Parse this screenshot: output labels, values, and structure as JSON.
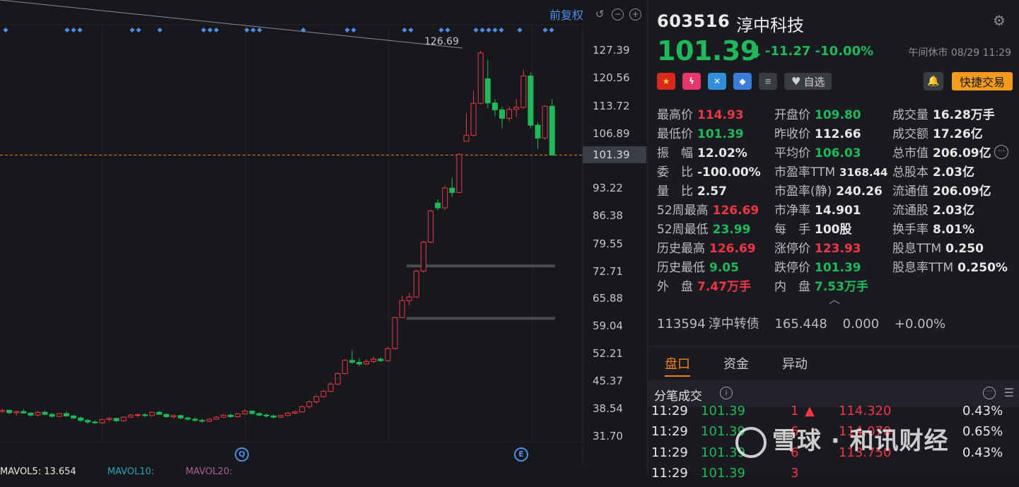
{
  "toolbar": {
    "adjust_label": "前复权"
  },
  "price_axis": [
    "127.39",
    "120.56",
    "113.72",
    "106.89",
    "101.39",
    "93.22",
    "86.38",
    "79.55",
    "72.71",
    "65.88",
    "59.04",
    "52.21",
    "45.37",
    "38.54",
    "31.70"
  ],
  "chart_annotations": {
    "high_label": "126.69",
    "marker_q": "Q",
    "marker_e": "E"
  },
  "mavol": {
    "ma5": "MAVOL5: 13.654",
    "ma10": "MAVOL10:",
    "ma20": "MAVOL20:"
  },
  "chart_data": {
    "type": "candlestick",
    "y_range": [
      31.7,
      127.39
    ],
    "current_price": 101.39,
    "period_high": 126.69,
    "candles": [
      [
        37.8,
        38.5,
        37.4,
        38.1
      ],
      [
        38.1,
        38.3,
        37.2,
        37.5
      ],
      [
        37.5,
        38.0,
        36.8,
        37.8
      ],
      [
        37.8,
        38.4,
        37.3,
        37.4
      ],
      [
        37.4,
        37.6,
        36.5,
        36.9
      ],
      [
        36.9,
        37.9,
        36.6,
        37.6
      ],
      [
        37.6,
        38.0,
        36.9,
        37.1
      ],
      [
        37.1,
        37.5,
        36.3,
        36.6
      ],
      [
        36.6,
        37.5,
        36.4,
        37.3
      ],
      [
        37.3,
        37.8,
        36.5,
        36.7
      ],
      [
        36.7,
        37.0,
        35.9,
        36.2
      ],
      [
        36.2,
        36.6,
        35.3,
        35.6
      ],
      [
        35.6,
        36.0,
        34.8,
        35.2
      ],
      [
        35.2,
        35.6,
        34.6,
        35.0
      ],
      [
        35.0,
        36.0,
        34.7,
        35.8
      ],
      [
        35.8,
        36.4,
        35.4,
        36.1
      ],
      [
        36.1,
        36.3,
        35.2,
        35.5
      ],
      [
        35.5,
        36.6,
        35.3,
        36.4
      ],
      [
        36.4,
        37.2,
        36.2,
        36.9
      ],
      [
        36.9,
        37.3,
        36.3,
        37.0
      ],
      [
        37.0,
        37.4,
        36.4,
        36.8
      ],
      [
        36.8,
        37.8,
        36.6,
        37.6
      ],
      [
        37.6,
        38.0,
        37.0,
        37.1
      ],
      [
        37.1,
        37.3,
        36.2,
        36.5
      ],
      [
        36.5,
        37.0,
        36.0,
        36.8
      ],
      [
        36.8,
        37.0,
        35.9,
        36.2
      ],
      [
        36.2,
        36.5,
        35.6,
        35.9
      ],
      [
        35.9,
        36.3,
        35.3,
        35.6
      ],
      [
        35.6,
        36.0,
        35.0,
        35.4
      ],
      [
        35.4,
        36.2,
        35.2,
        35.9
      ],
      [
        35.9,
        36.7,
        35.7,
        36.4
      ],
      [
        36.4,
        37.1,
        36.2,
        36.9
      ],
      [
        36.9,
        37.3,
        36.3,
        36.5
      ],
      [
        36.5,
        37.5,
        36.3,
        37.2
      ],
      [
        37.2,
        38.3,
        37.0,
        37.9
      ],
      [
        37.9,
        38.1,
        37.0,
        37.3
      ],
      [
        37.3,
        37.6,
        36.6,
        36.9
      ],
      [
        36.9,
        37.3,
        36.3,
        36.7
      ],
      [
        36.7,
        37.0,
        36.0,
        36.4
      ],
      [
        36.4,
        37.0,
        36.2,
        36.8
      ],
      [
        36.8,
        37.7,
        36.6,
        37.4
      ],
      [
        37.4,
        38.0,
        37.1,
        37.7
      ],
      [
        37.7,
        39.4,
        37.5,
        39.0
      ],
      [
        39.0,
        40.5,
        38.6,
        40.2
      ],
      [
        40.2,
        41.8,
        39.8,
        41.5
      ],
      [
        41.5,
        43.2,
        41.2,
        42.8
      ],
      [
        42.8,
        45.0,
        42.5,
        44.6
      ],
      [
        44.6,
        47.5,
        44.3,
        47.2
      ],
      [
        47.2,
        50.8,
        47.0,
        50.5
      ],
      [
        50.5,
        53.0,
        49.5,
        50.0
      ],
      [
        50.0,
        51.0,
        49.0,
        49.6
      ],
      [
        49.6,
        50.8,
        49.3,
        50.2
      ],
      [
        50.2,
        51.5,
        49.8,
        50.8
      ],
      [
        50.8,
        51.2,
        50.0,
        50.4
      ],
      [
        50.4,
        53.8,
        50.2,
        53.4
      ],
      [
        53.4,
        61.3,
        53.2,
        61.1
      ],
      [
        61.1,
        66.5,
        61.0,
        65.3
      ],
      [
        65.3,
        67.2,
        64.0,
        66.2
      ],
      [
        66.2,
        73.0,
        66.0,
        72.6
      ],
      [
        72.6,
        80.2,
        72.2,
        79.8
      ],
      [
        79.8,
        87.8,
        79.5,
        87.5
      ],
      [
        89.5,
        90.4,
        87.6,
        88.3
      ],
      [
        88.3,
        93.8,
        87.8,
        93.2
      ],
      [
        93.2,
        95.8,
        91.0,
        92.1
      ],
      [
        92.1,
        101.8,
        91.9,
        101.5
      ],
      [
        104.8,
        111.7,
        104.7,
        106.3
      ],
      [
        106.3,
        117.3,
        106.0,
        114.2
      ],
      [
        114.2,
        127.2,
        114.0,
        126.69
      ],
      [
        120.3,
        125.0,
        113.0,
        114.3
      ],
      [
        114.3,
        115.2,
        111.0,
        112.6
      ],
      [
        112.6,
        113.4,
        108.0,
        110.5
      ],
      [
        110.5,
        113.5,
        109.6,
        112.7
      ],
      [
        112.7,
        115.3,
        110.8,
        113.2
      ],
      [
        113.2,
        122.5,
        112.8,
        121.0
      ],
      [
        121.0,
        121.9,
        108.0,
        108.8
      ],
      [
        108.8,
        109.5,
        102.9,
        105.6
      ],
      [
        105.6,
        113.8,
        105.2,
        113.5
      ],
      [
        113.5,
        115.2,
        101.39,
        101.39
      ]
    ],
    "horizontal_levels": [
      73.9,
      60.9
    ]
  },
  "header": {
    "code": "603516",
    "name": "淳中科技",
    "price": "101.39",
    "arrow": "⬇",
    "change": "-11.27",
    "change_pct": "-10.00%",
    "status": "午间休市 08/29 11:29"
  },
  "badges": {
    "fav_label": "自选",
    "quick_trade": "快捷交易"
  },
  "stats": [
    [
      {
        "label": "最高价",
        "value": "114.93",
        "color": "red"
      },
      {
        "label": "开盘价",
        "value": "109.80",
        "color": "green"
      },
      {
        "label": "成交量",
        "value": "16.28万手",
        "color": "white"
      }
    ],
    [
      {
        "label": "最低价",
        "value": "101.39",
        "color": "green"
      },
      {
        "label": "昨收价",
        "value": "112.66",
        "color": "white"
      },
      {
        "label": "成交额",
        "value": "17.26亿",
        "color": "white"
      }
    ],
    [
      {
        "label": "振　幅",
        "value": "12.02%",
        "color": "white"
      },
      {
        "label": "平均价",
        "value": "106.03",
        "color": "green"
      },
      {
        "label": "总市值",
        "value": "206.09亿",
        "color": "white"
      }
    ],
    [
      {
        "label": "委　比",
        "value": "-100.00%",
        "color": "white"
      },
      {
        "label": "市盈率TTM",
        "value": "3168.44",
        "color": "white"
      },
      {
        "label": "总股本",
        "value": "2.03亿",
        "color": "white"
      }
    ],
    [
      {
        "label": "量　比",
        "value": "2.57",
        "color": "white"
      },
      {
        "label": "市盈率(静)",
        "value": "240.26",
        "color": "white"
      },
      {
        "label": "流通值",
        "value": "206.09亿",
        "color": "white"
      }
    ],
    [
      {
        "label": "52周最高",
        "value": "126.69",
        "color": "red"
      },
      {
        "label": "市净率",
        "value": "14.901",
        "color": "white"
      },
      {
        "label": "流通股",
        "value": "2.03亿",
        "color": "white"
      }
    ],
    [
      {
        "label": "52周最低",
        "value": "23.99",
        "color": "green"
      },
      {
        "label": "每　手",
        "value": "100股",
        "color": "white"
      },
      {
        "label": "换手率",
        "value": "8.01%",
        "color": "white"
      }
    ],
    [
      {
        "label": "历史最高",
        "value": "126.69",
        "color": "red"
      },
      {
        "label": "涨停价",
        "value": "123.93",
        "color": "red"
      },
      {
        "label": "股息TTM",
        "value": "0.250",
        "color": "white"
      }
    ],
    [
      {
        "label": "历史最低",
        "value": "9.05",
        "color": "green"
      },
      {
        "label": "跌停价",
        "value": "101.39",
        "color": "green"
      },
      {
        "label": "股息率TTM",
        "value": "0.250%",
        "color": "white"
      }
    ],
    [
      {
        "label": "外　盘",
        "value": "7.47万手",
        "color": "red"
      },
      {
        "label": "内　盘",
        "value": "7.53万手",
        "color": "green"
      }
    ]
  ],
  "convertible": {
    "code": "113594",
    "name": "淳中转债",
    "price": "165.448",
    "change": "0.000",
    "change_pct": "+0.00%"
  },
  "tabs": [
    "盘口",
    "资金",
    "异动"
  ],
  "ticks_title": "分笔成交",
  "ticks": [
    {
      "time": "11:29",
      "price": "101.39",
      "vol": "1",
      "dir": "▲"
    },
    {
      "time": "11:29",
      "price": "101.39",
      "vol": "6",
      "dir": ""
    },
    {
      "time": "11:29",
      "price": "101.39",
      "vol": "6",
      "dir": ""
    },
    {
      "time": "11:29",
      "price": "101.39",
      "vol": "3",
      "dir": ""
    }
  ],
  "side_list": [
    {
      "price": "114.320",
      "pct": "0.43%"
    },
    {
      "price": "114.070",
      "pct": "0.65%"
    },
    {
      "price": "113.750",
      "pct": "0.43%"
    }
  ],
  "watermark": "雪球 · 和讯财经",
  "colors": {
    "up": "#f23645",
    "down": "#1fb85a",
    "accent": "#f2841e",
    "link": "#4d8fe8"
  }
}
